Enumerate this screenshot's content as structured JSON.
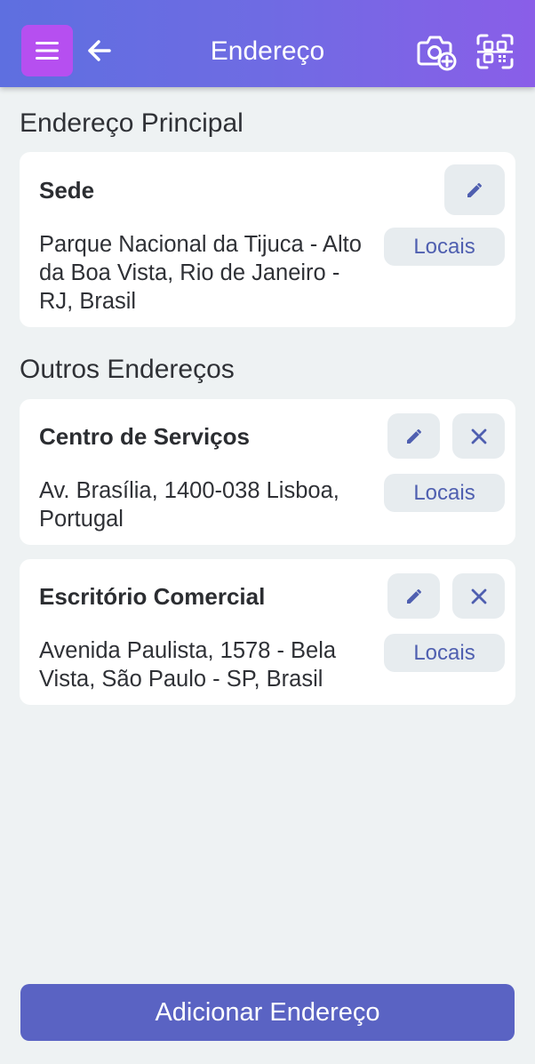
{
  "header": {
    "title": "Endereço",
    "icons": {
      "menu": "hamburger-menu-icon",
      "back": "arrow-left-icon",
      "camera": "camera-add-icon",
      "scan": "qr-scan-icon"
    }
  },
  "main_section": {
    "title": "Endereço Principal",
    "card": {
      "name": "Sede",
      "address": "Parque Nacional da Tijuca - Alto da Boa Vista, Rio de Janeiro - RJ, Brasil",
      "locais_label": "Locais"
    }
  },
  "other_section": {
    "title": "Outros Endereços",
    "cards": [
      {
        "name": "Centro de Serviços",
        "address": "Av. Brasília, 1400-038 Lisboa, Portugal",
        "locais_label": "Locais"
      },
      {
        "name": "Escritório Comercial",
        "address": "Avenida Paulista, 1578 - Bela Vista, São Paulo - SP, Brasil",
        "locais_label": "Locais"
      }
    ]
  },
  "footer": {
    "add_label": "Adicionar Endereço"
  },
  "colors": {
    "header_gradient_start": "#5e6fe0",
    "header_gradient_end": "#8a5ee8",
    "menu_button": "#b64ff0",
    "primary_button": "#5a63c3",
    "accent_text": "#4f5fb0",
    "background": "#eef2f3"
  }
}
